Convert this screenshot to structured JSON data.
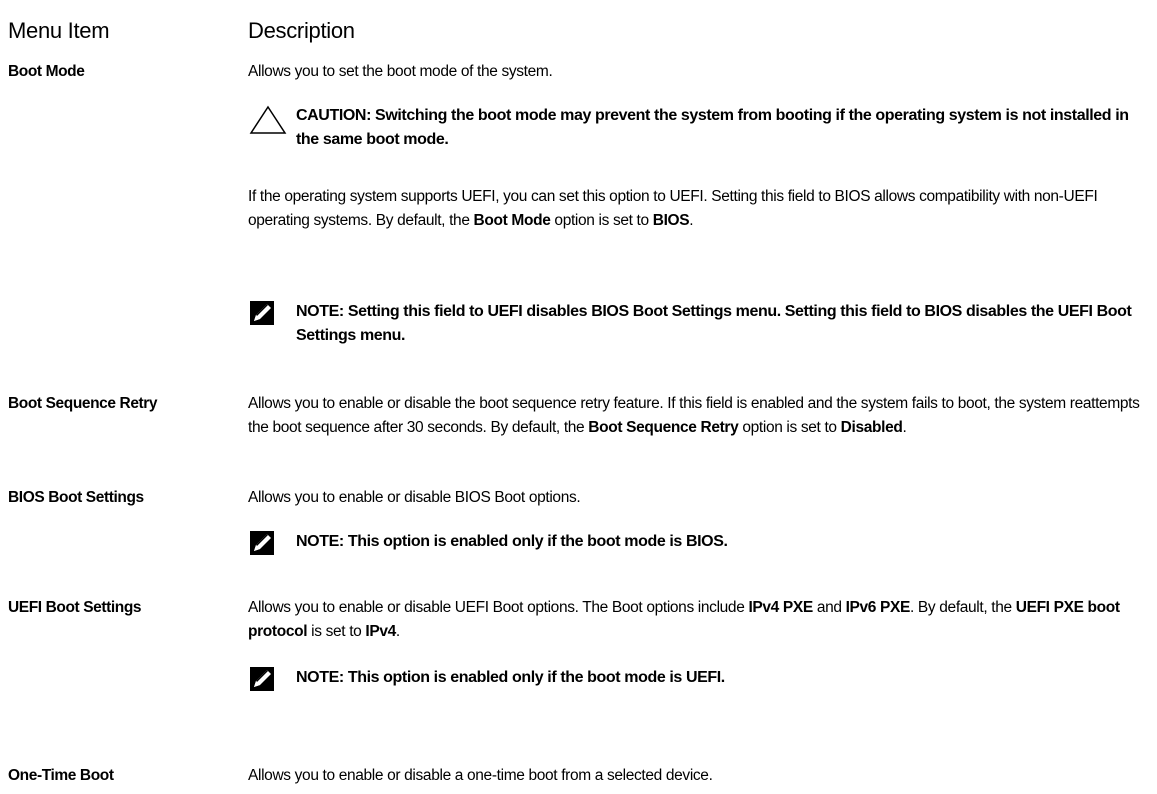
{
  "header": {
    "menu_item": "Menu Item",
    "description": "Description"
  },
  "rows": [
    {
      "label": "Boot Mode",
      "description": "Allows you to set the boot mode of the system.",
      "caution": "CAUTION: Switching the boot mode may prevent the system from booting if the operating system is not installed in the same boot mode.",
      "para2": {
        "pre": "If the operating system supports UEFI, you can set this option to UEFI. Setting this field to BIOS allows compatibility with non-UEFI operating systems. By default, the ",
        "bold1": "Boot Mode",
        "mid": " option is set to ",
        "bold2": "BIOS",
        "post": "."
      },
      "note": "NOTE: Setting this field to UEFI disables BIOS Boot Settings menu. Setting this field to BIOS disables the UEFI Boot Settings menu."
    },
    {
      "label": "Boot Sequence Retry",
      "description": {
        "pre": "Allows you to enable or disable the boot sequence retry feature. If this field is enabled and the system fails to boot, the system reattempts the boot sequence after 30 seconds. By default, the ",
        "bold1": "Boot Sequence Retry",
        "mid": " option is set to ",
        "bold2": "Disabled",
        "post": "."
      }
    },
    {
      "label": "BIOS Boot Settings",
      "description": "Allows you to enable or disable BIOS Boot options.",
      "note": "NOTE: This option is enabled only if the boot mode is BIOS."
    },
    {
      "label": "UEFI Boot Settings",
      "description": {
        "t1": "Allows you to enable or disable UEFI Boot options. The Boot options include ",
        "b1": "IPv4 PXE",
        "t2": " and ",
        "b2": "IPv6 PXE",
        "t3": ". By default, the ",
        "b3": "UEFI PXE boot protocol",
        "t4": " is set to ",
        "b4": "IPv4",
        "t5": "."
      },
      "note": "NOTE: This option is enabled only if the boot mode is UEFI."
    },
    {
      "label": "One-Time Boot",
      "description": "Allows you to enable or disable a one-time boot from a selected device."
    }
  ],
  "icons": {
    "caution": "caution-triangle-icon",
    "note": "note-pencil-icon"
  }
}
